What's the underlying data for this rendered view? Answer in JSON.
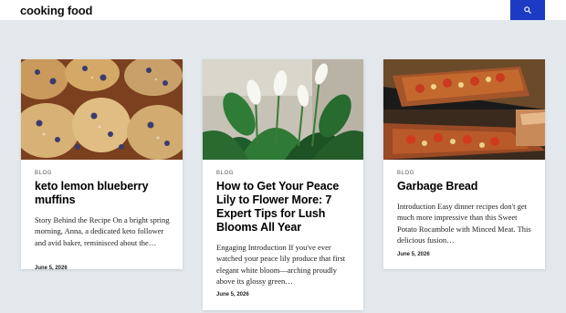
{
  "site": {
    "title": "cooking food"
  },
  "header": {
    "search_icon": "search-icon",
    "accent_color": "#1d3ac4"
  },
  "posts": [
    {
      "image": "blueberry-muffins-photo",
      "category": "BLOG",
      "title": "keto lemon blueberry muffins",
      "excerpt": "Story Behind the Recipe On a bright spring morning, Anna, a dedicated keto follower and avid baker, reminisced about the…",
      "date": "June 5, 2026"
    },
    {
      "image": "peace-lily-photo",
      "category": "BLOG",
      "title": "How to Get Your Peace Lily to Flower More: 7 Expert Tips for Lush Blooms All Year",
      "excerpt": "Engaging Introduction If you've ever watched your peace lily produce that first elegant white bloom—arching proudly above its glossy green…",
      "date": "June 5, 2026"
    },
    {
      "image": "garbage-bread-photo",
      "category": "BLOG",
      "title": "Garbage Bread",
      "excerpt": "Introduction Easy dinner recipes don't get much more impressive than this Sweet Potato Rocambole with Minced Meat. This delicious fusion…",
      "date": "June 5, 2026"
    }
  ]
}
